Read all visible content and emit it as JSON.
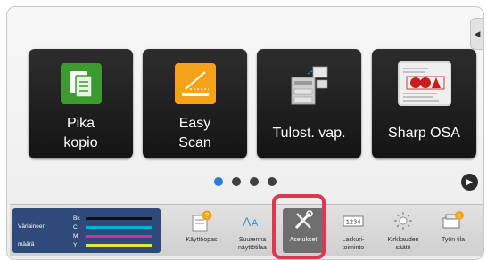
{
  "tiles": [
    {
      "label_line1": "Pika",
      "label_line2": "kopio",
      "icon": "copy-icon",
      "color": "#3c9b2f"
    },
    {
      "label_line1": "Easy",
      "label_line2": "Scan",
      "icon": "scanner-icon",
      "color": "#f5a218"
    },
    {
      "label": "Tulost. vap.",
      "icon": "printer-icon"
    },
    {
      "label": "Sharp OSA",
      "icon": "sharp-osa-icon"
    }
  ],
  "pagination": {
    "pages": 4,
    "current": 1
  },
  "toner": {
    "title_line1": "Väriaineen",
    "title_line2": "määrä",
    "colors": [
      {
        "name": "Bk",
        "color": "#111111"
      },
      {
        "name": "C",
        "color": "#00b4d8"
      },
      {
        "name": "M",
        "color": "#d0309c"
      },
      {
        "name": "Y",
        "color": "#e8e23a"
      }
    ]
  },
  "functions": [
    {
      "line1": "Käyttöopas",
      "line2": "",
      "icon": "manual-icon"
    },
    {
      "line1": "Suurenna",
      "line2": "näyttötilaa",
      "icon": "magnify-text-icon"
    },
    {
      "line1": "Asetukset",
      "line2": "",
      "icon": "settings-tools-icon",
      "selected": true
    },
    {
      "line1": "Laskuri-",
      "line2": "toiminto",
      "icon": "counter-icon"
    },
    {
      "line1": "Kirkkauden",
      "line2": "säätö",
      "icon": "brightness-icon"
    },
    {
      "line1": "Työn tila",
      "line2": "",
      "icon": "job-status-icon"
    }
  ],
  "highlight_color": "#d93a4f"
}
